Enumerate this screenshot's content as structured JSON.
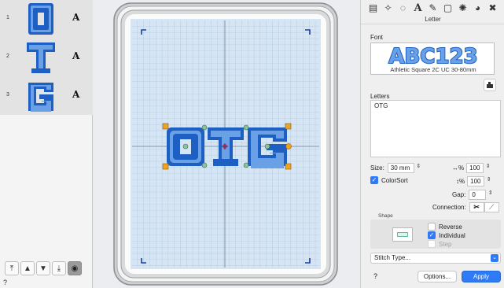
{
  "object_list": {
    "rows": [
      {
        "number": "1",
        "letter": "O",
        "type": "A"
      },
      {
        "number": "2",
        "letter": "T",
        "type": "A"
      },
      {
        "number": "3",
        "letter": "G",
        "type": "A"
      }
    ]
  },
  "left_toolbar": {
    "buttons": [
      {
        "icon": "move-to-top-icon",
        "glyph": "⤒"
      },
      {
        "icon": "move-up-icon",
        "glyph": "▲"
      },
      {
        "icon": "move-down-icon",
        "glyph": "▼"
      },
      {
        "icon": "move-to-bottom-icon",
        "glyph": "⤓"
      },
      {
        "icon": "view-toggle-icon",
        "glyph": "◉"
      }
    ],
    "help": "?"
  },
  "canvas": {
    "design_text": "OTG"
  },
  "tools": [
    "layers-icon",
    "node-edit-icon",
    "lasso-icon",
    "letter-tool-icon",
    "applique-icon",
    "frame-icon",
    "fill-icon",
    "circle-icon",
    "crossstitch-icon"
  ],
  "panel": {
    "title": "Letter",
    "font_label": "Font",
    "font_preview": "ABC123",
    "font_name": "Athletic Square 2C UC 30-80mm",
    "letters_label": "Letters",
    "letters_value": "OTG",
    "size_label": "Size:",
    "size_value": "30 mm",
    "width_symbol": "↔%",
    "width_value": "100",
    "colorsort_label": "ColorSort",
    "height_symbol": "↕%",
    "height_value": "100",
    "gap_label": "Gap:",
    "gap_value": "0",
    "connection_label": "Connection:",
    "shape_label": "Shape",
    "reverse_label": "Reverse",
    "individual_label": "Individual",
    "step_label": "Step",
    "stitch_type_label": "Stitch Type...",
    "help": "?",
    "options_label": "Options...",
    "apply_label": "Apply"
  },
  "colors": {
    "accent": "#2f7bf6",
    "letter_blue": "#1d5fc2",
    "hoop_grid": "#cfe0f2"
  }
}
